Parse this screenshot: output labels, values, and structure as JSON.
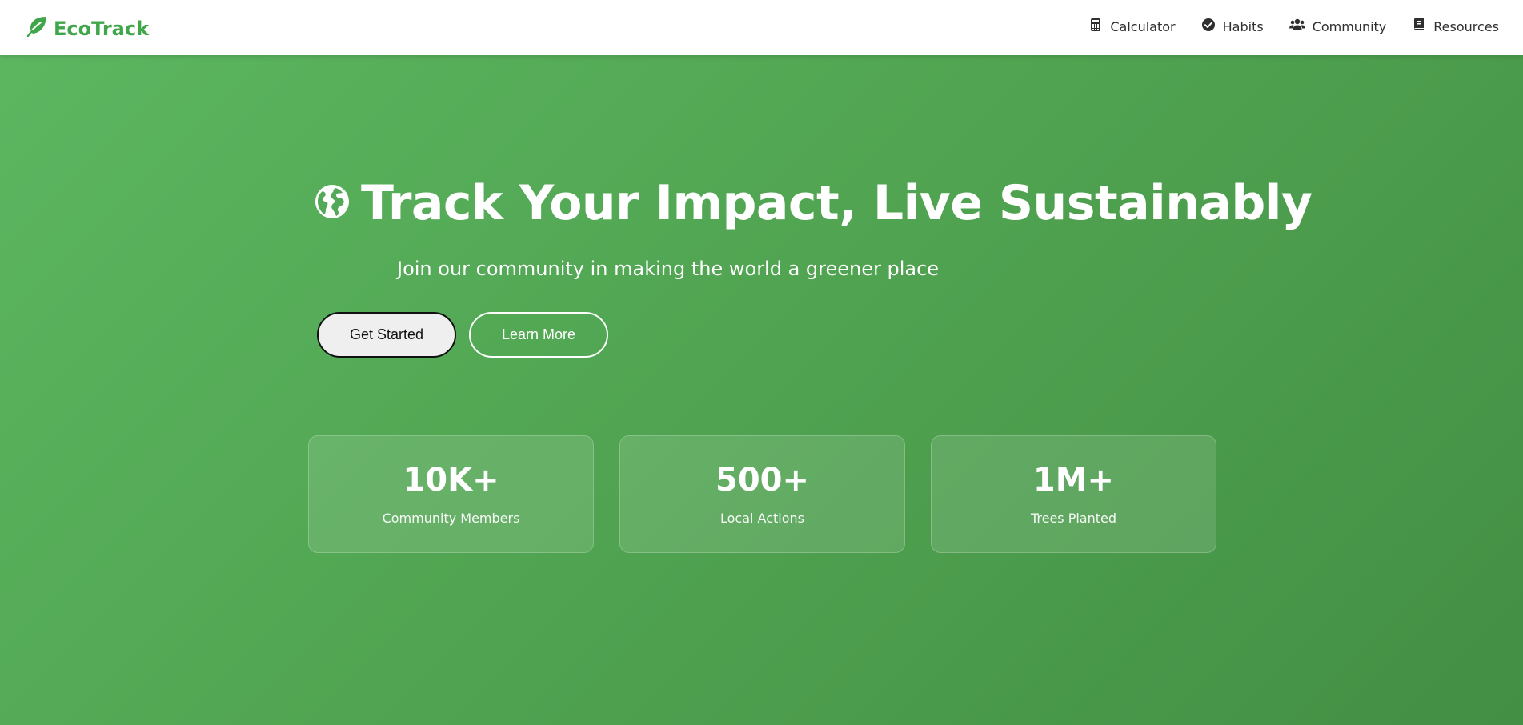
{
  "brand": {
    "name": "EcoTrack",
    "icon": "leaf-icon",
    "color": "#3fa64a"
  },
  "nav": {
    "items": [
      {
        "label": "Calculator",
        "icon": "calculator-icon"
      },
      {
        "label": "Habits",
        "icon": "check-circle-icon"
      },
      {
        "label": "Community",
        "icon": "users-icon"
      },
      {
        "label": "Resources",
        "icon": "book-icon"
      }
    ]
  },
  "hero": {
    "icon": "globe-icon",
    "title": "Track Your Impact, Live Sustainably",
    "subtitle": "Join our community in making the world a greener place",
    "primary_button": "Get Started",
    "secondary_button": "Learn More",
    "background_start": "#5cb660",
    "background_end": "#438f44"
  },
  "stats": [
    {
      "value": "10K+",
      "label": "Community Members"
    },
    {
      "value": "500+",
      "label": "Local Actions"
    },
    {
      "value": "1M+",
      "label": "Trees Planted"
    }
  ]
}
